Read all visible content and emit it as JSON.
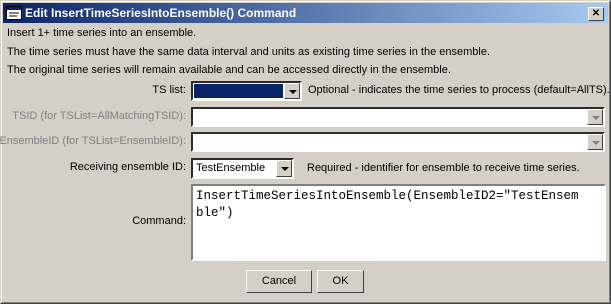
{
  "window": {
    "title": "Edit InsertTimeSeriesIntoEnsemble() Command"
  },
  "description": [
    "Insert 1+ time series into an ensemble.",
    "The time series must have the same data interval and units as existing time series in the ensemble.",
    "The original time series will remain available and can be accessed directly in the ensemble."
  ],
  "form": {
    "ts_list": {
      "label": "TS list:",
      "value": "",
      "note": "Optional - indicates the time series to process (default=AllTS)."
    },
    "tsid": {
      "label": "TSID (for TSList=AllMatchingTSID):",
      "value": ""
    },
    "ensembleid": {
      "label": "EnsembleID (for TSList=EnsembleID):",
      "value": ""
    },
    "receiving": {
      "label": "Receiving ensemble ID:",
      "value": "TestEnsemble",
      "note": "Required - identifier for ensemble to receive time series."
    },
    "command": {
      "label": "Command:",
      "text": "InsertTimeSeriesIntoEnsemble(EnsembleID2=\"TestEnsem\nble\")"
    }
  },
  "buttons": {
    "cancel": "Cancel",
    "ok": "OK"
  },
  "colors": {
    "titlebar_start": "#0a246a",
    "selection": "#0a246a",
    "face": "#d4d0c8"
  },
  "icons": [
    "window-app-icon",
    "close-icon",
    "chevron-down-icon"
  ]
}
